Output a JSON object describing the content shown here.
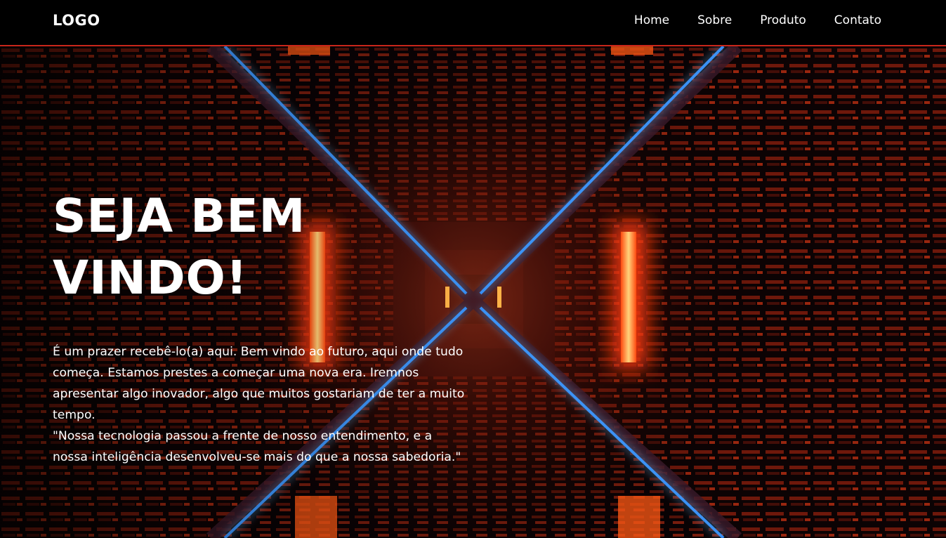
{
  "header": {
    "logo": "LOGO",
    "nav": [
      {
        "label": "Home"
      },
      {
        "label": "Sobre"
      },
      {
        "label": "Produto"
      },
      {
        "label": "Contato"
      }
    ]
  },
  "hero": {
    "title": "SEJA BEM VINDO!",
    "paragraphs": [
      "É um prazer recebê-lo(a) aqui. Bem vindo ao futuro, aqui onde tudo começa. Estamos prestes a começar uma nova era. Iremnos apresentar algo inovador, algo que muitos gostariam de ter a muito tempo.",
      "\"Nossa tecnologia passou a frente de nosso entendimento, e a nossa inteligência desenvolveu-se mais do que a nossa sabedoria.\""
    ]
  },
  "colors": {
    "header_bg": "#000000",
    "header_border": "#c9261a",
    "accent_orange": "#ff6a1a",
    "accent_blue": "#2f8cff",
    "text": "#ffffff"
  }
}
